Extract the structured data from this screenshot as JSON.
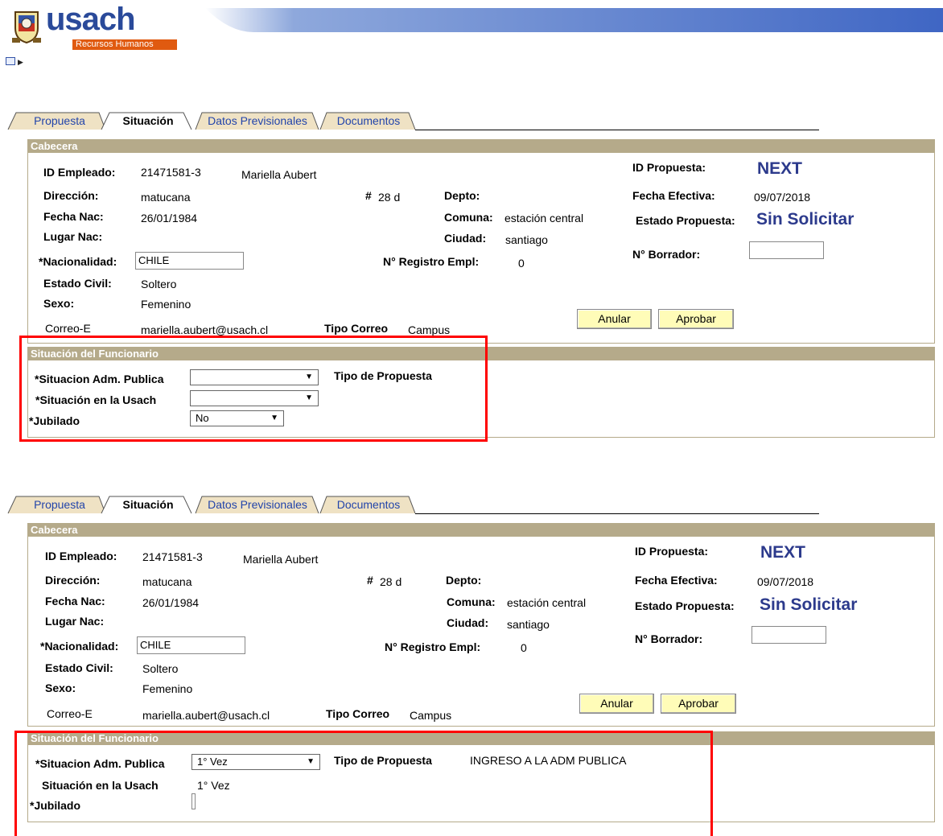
{
  "brand": {
    "logo_text": "usach",
    "logo_subtitle": "Recursos Humanos"
  },
  "tabs": [
    "Propuesta",
    "Situación",
    "Datos Previsionales",
    "Documentos"
  ],
  "cabecera": {
    "section_title": "Cabecera",
    "labels": {
      "id_empleado": "ID Empleado:",
      "direccion": "Dirección:",
      "numero": "#",
      "depto": "Depto:",
      "fecha_nac": "Fecha Nac:",
      "comuna": "Comuna:",
      "lugar_nac": "Lugar Nac:",
      "ciudad": "Ciudad:",
      "nacionalidad": "*Nacionalidad:",
      "registro": "N° Registro Empl:",
      "estado_civil": "Estado Civil:",
      "sexo": "Sexo:",
      "correo": "Correo-E",
      "tipo_correo": "Tipo Correo",
      "id_propuesta": "ID Propuesta:",
      "fecha_efectiva": "Fecha Efectiva:",
      "estado_propuesta": "Estado Propuesta:",
      "borrador": "N° Borrador:"
    },
    "values": {
      "id_empleado": "21471581-3",
      "nombre": "Mariella Aubert",
      "direccion": "matucana",
      "numero": "28 d",
      "fecha_nac": "26/01/1984",
      "comuna": "estación central",
      "ciudad": "santiago",
      "nacionalidad": "CHILE",
      "registro": "0",
      "estado_civil": "Soltero",
      "sexo": "Femenino",
      "correo": "mariella.aubert@usach.cl",
      "tipo_correo": "Campus",
      "id_propuesta": "NEXT",
      "fecha_efectiva": "09/07/2018",
      "estado_propuesta": "Sin Solicitar",
      "borrador": ""
    },
    "buttons": {
      "anular": "Anular",
      "aprobar": "Aprobar"
    }
  },
  "situacion": {
    "section_title": "Situación del Funcionario",
    "labels": {
      "adm_publica": "*Situacion Adm. Publica",
      "en_usach_req": "*Situación en la Usach",
      "en_usach": "Situación en la Usach",
      "jubilado": "*Jubilado",
      "tipo_propuesta": "Tipo de Propuesta"
    },
    "before": {
      "adm_publica": "",
      "en_usach": "",
      "jubilado": "No",
      "tipo_propuesta": ""
    },
    "after": {
      "adm_publica": "1° Vez",
      "en_usach": "1° Vez",
      "tipo_propuesta": "INGRESO A LA ADM PUBLICA"
    }
  },
  "colors": {
    "section_bar": "#b5aa8a",
    "accent_blue": "#2c3a8c",
    "link_blue": "#2244aa",
    "highlight_red": "#ff0000",
    "button_yellow": "#fffcb8"
  }
}
